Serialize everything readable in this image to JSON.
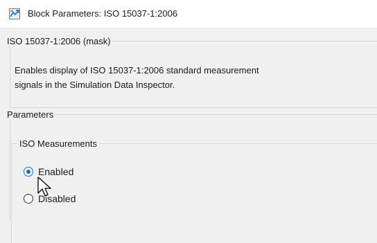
{
  "window": {
    "title": "Block Parameters: ISO 15037-1:2006",
    "icon": "block-parameters-icon"
  },
  "mask_group": {
    "legend": "ISO 15037-1:2006 (mask)",
    "description_line1": "Enables display of ISO 15037-1:2006 standard measurement",
    "description_line2": "signals in the Simulation Data Inspector."
  },
  "parameters_group": {
    "legend": "Parameters"
  },
  "iso_measurements": {
    "legend": "ISO Measurements",
    "selected": "Enabled",
    "options": [
      {
        "label": "Enabled",
        "checked": true
      },
      {
        "label": "Disabled",
        "checked": false
      }
    ]
  },
  "colors": {
    "accent": "#0a6ee0",
    "background": "#f0f0f0",
    "titlebar": "#ffffff"
  }
}
